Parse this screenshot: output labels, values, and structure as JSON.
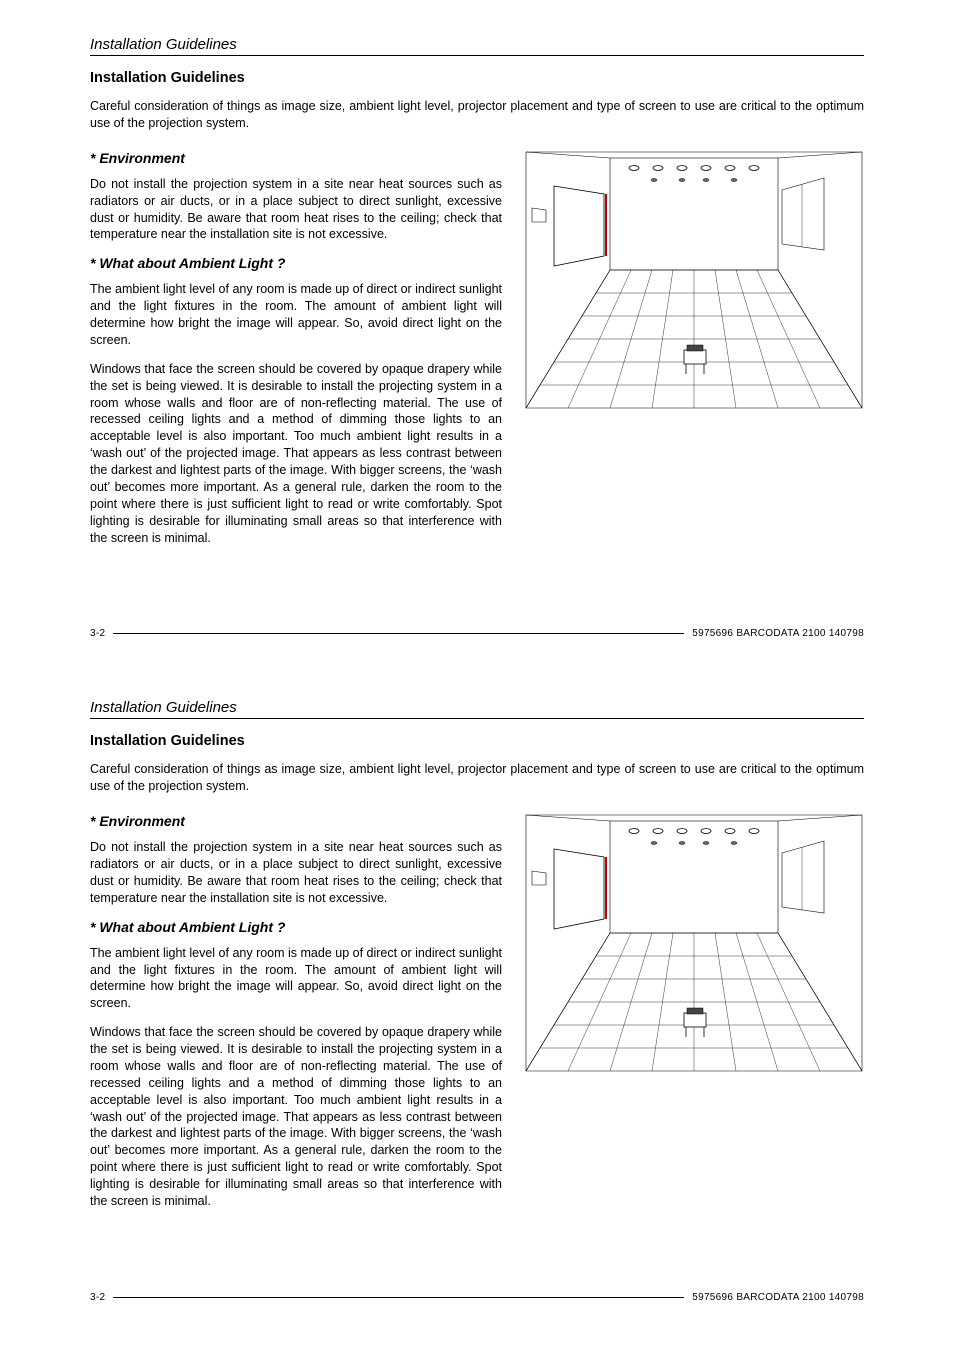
{
  "running_head": "Installation Guidelines",
  "title": "Installation Guidelines",
  "intro": "Careful consideration of things as image size, ambient light level, projector placement and type of screen to use are critical to the optimum use of the projection system.",
  "env": {
    "heading": "* Environment",
    "body": "Do not install the projection system in a site near heat sources such as radiators or air ducts, or in a place subject to direct sunlight, excessive dust or humidity.  Be aware that room heat rises to the ceiling; check that temperature near the installation site is not excessive."
  },
  "ambient": {
    "heading": "* What about Ambient Light ?",
    "p1": "The ambient light level of any room is made up of direct or indirect sunlight and the light fixtures in the room.  The amount of ambient light will determine how bright the image will appear.  So, avoid direct light on the screen.",
    "p2": "Windows that face the screen should be covered by opaque drapery while the set is being viewed.  It is desirable to install the projecting system in a room whose walls and floor are of non-reflecting material.  The use of recessed ceiling lights and a method of dimming those lights to an acceptable level is also important.  Too much ambient light results in a ‘wash out’ of the projected image.  That appears as less contrast between the darkest and lightest parts of the image.  With bigger screens, the ‘wash out’ becomes more important.  As a general rule, darken the room to the point where there is just sufficient light to read or write comfortably.  Spot lighting is desirable for illuminating small areas so that interference with the screen is minimal."
  },
  "footer": {
    "page": "3-2",
    "docid": "5975696 BARCODATA 2100 140798"
  }
}
